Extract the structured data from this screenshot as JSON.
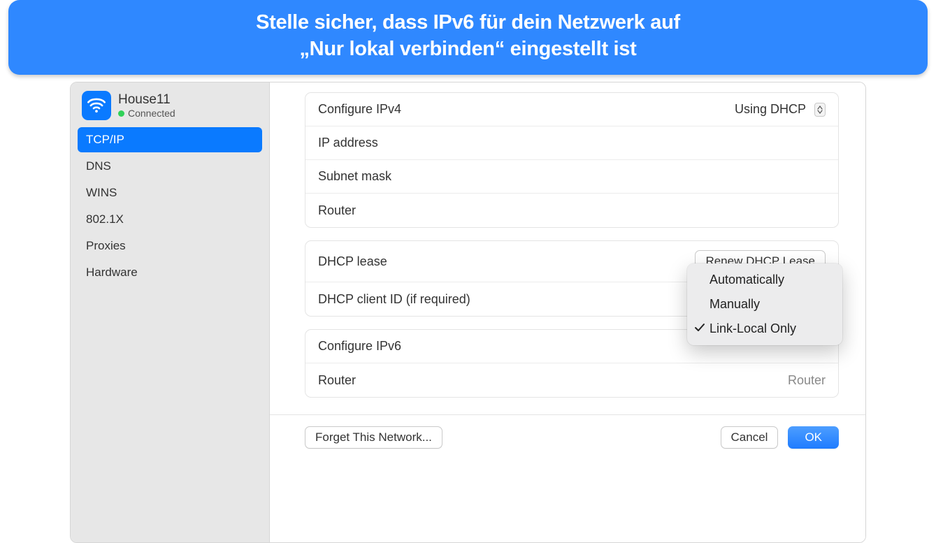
{
  "banner": {
    "line1": "Stelle sicher, dass IPv6 für dein Netzwerk auf",
    "line2": "„Nur lokal verbinden“ eingestellt ist"
  },
  "network": {
    "name": "House11",
    "status": "Connected"
  },
  "sidebar": {
    "items": [
      "TCP/IP",
      "DNS",
      "WINS",
      "802.1X",
      "Proxies",
      "Hardware"
    ],
    "active_index": 0
  },
  "ipv4": {
    "configure_label": "Configure IPv4",
    "configure_value": "Using DHCP",
    "ip_label": "IP address",
    "subnet_label": "Subnet mask",
    "router_label": "Router"
  },
  "dhcp": {
    "lease_label": "DHCP lease",
    "renew_button": "Renew DHCP Lease",
    "client_id_label": "DHCP client ID (if required)"
  },
  "ipv6": {
    "configure_label": "Configure IPv6",
    "options": [
      "Automatically",
      "Manually",
      "Link-Local Only"
    ],
    "selected_index": 2,
    "router_label": "Router",
    "router_value": "Router"
  },
  "footer": {
    "forget_button": "Forget This Network...",
    "cancel_button": "Cancel",
    "ok_button": "OK"
  },
  "colors": {
    "accent": "#0a7aff",
    "banner": "#2f88ff",
    "green": "#30d158"
  }
}
